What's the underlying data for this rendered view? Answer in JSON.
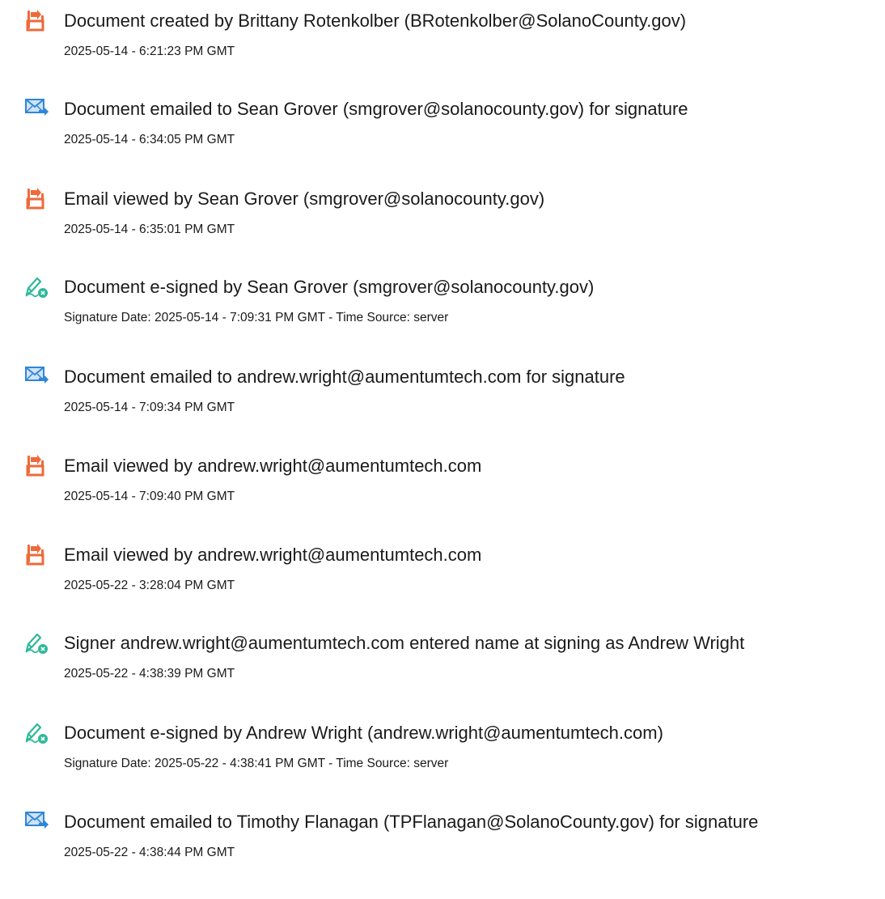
{
  "events": [
    {
      "icon": "document-created-icon",
      "text": "Document created by Brittany Rotenkolber (BRotenkolber@SolanoCounty.gov)",
      "date": "2025-05-14 - 6:21:23 PM GMT"
    },
    {
      "icon": "email-sent-icon",
      "text": "Document emailed to Sean Grover (smgrover@solanocounty.gov) for signature",
      "date": "2025-05-14 - 6:34:05 PM GMT"
    },
    {
      "icon": "email-viewed-icon",
      "text": "Email viewed by Sean Grover (smgrover@solanocounty.gov)",
      "date": "2025-05-14 - 6:35:01 PM GMT"
    },
    {
      "icon": "e-sign-pen-icon",
      "text": "Document e-signed by Sean Grover (smgrover@solanocounty.gov)",
      "date": "Signature Date: 2025-05-14 - 7:09:31 PM GMT - Time Source: server"
    },
    {
      "icon": "email-sent-icon",
      "text": "Document emailed to andrew.wright@aumentumtech.com for signature",
      "date": "2025-05-14 - 7:09:34 PM GMT"
    },
    {
      "icon": "email-viewed-icon",
      "text": "Email viewed by andrew.wright@aumentumtech.com",
      "date": "2025-05-14 - 7:09:40 PM GMT"
    },
    {
      "icon": "email-viewed-icon",
      "text": "Email viewed by andrew.wright@aumentumtech.com",
      "date": "2025-05-22 - 3:28:04 PM GMT"
    },
    {
      "icon": "e-sign-pen-icon",
      "text": "Signer andrew.wright@aumentumtech.com entered name at signing as Andrew Wright",
      "date": "2025-05-22 - 4:38:39 PM GMT"
    },
    {
      "icon": "e-sign-pen-icon",
      "text": "Document e-signed by Andrew Wright (andrew.wright@aumentumtech.com)",
      "date": "Signature Date: 2025-05-22 - 4:38:41 PM GMT - Time Source: server"
    },
    {
      "icon": "email-sent-icon",
      "text": "Document emailed to Timothy Flanagan (TPFlanagan@SolanoCounty.gov) for signature",
      "date": "2025-05-22 - 4:38:44 PM GMT"
    }
  ],
  "colors": {
    "doc_orange": "#ee6a3a",
    "mail_blue": "#2f86d6",
    "mail_light": "#cfe3f6",
    "sign_green": "#2eb89a",
    "text": "#1a1a1a"
  }
}
